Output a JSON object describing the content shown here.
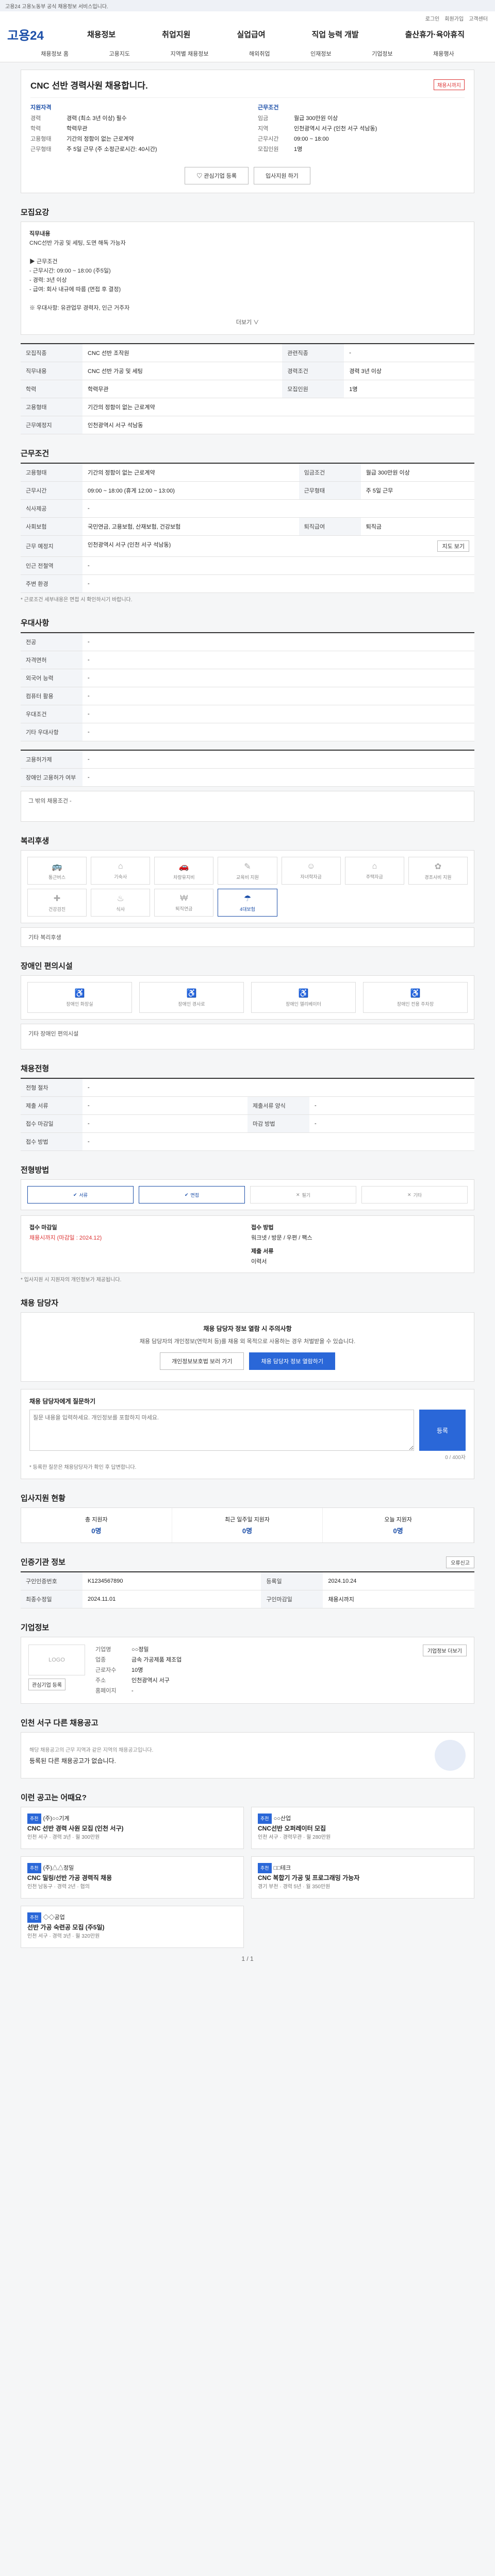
{
  "topstrip": {
    "text": "고용24 고용노동부 공식 채용정보 서비스입니다."
  },
  "header": {
    "logo": "고용24",
    "top_links": [
      "로그인",
      "회원가입",
      "고객센터"
    ],
    "gnb": [
      "채용정보",
      "취업지원",
      "실업급여",
      "직업 능력 개발",
      "출산휴가·육아휴직"
    ],
    "subnav": [
      "채용정보 홈",
      "고용지도",
      "지역별 채용정보",
      "해외취업",
      "인재정보",
      "기업정보",
      "채용행사"
    ]
  },
  "job": {
    "title": "CNC 선반 경력사원 채용합니다.",
    "badge": "채용시까지",
    "left_head": "지원자격",
    "right_head": "근무조건",
    "left_kv": [
      [
        "경력",
        "경력 (최소 3년 이상) 필수"
      ],
      [
        "학력",
        "학력무관"
      ],
      [
        "고용형태",
        "기간의 정함이 없는 근로계약"
      ],
      [
        "근무형태",
        "주 5일 근무 (주 소정근로시간: 40시간)"
      ]
    ],
    "right_kv": [
      [
        "임금",
        "월급 300만원 이상"
      ],
      [
        "지역",
        "인천광역시 서구 (인천 서구 석남동)"
      ],
      [
        "근무시간",
        "09:00 ~ 18:00"
      ],
      [
        "모집인원",
        "1명"
      ]
    ],
    "btn_like": "관심기업 등록",
    "btn_apply": "입사지원 하기"
  },
  "intro": {
    "title": "모집요강",
    "body": [
      "직무내용",
      "CNC선반 가공 및 세팅, 도면 해독 가능자",
      "▶ 근무조건",
      " - 근무시간: 09:00 ~ 18:00 (주5일)",
      " - 경력: 3년 이상",
      " - 급여: 회사 내규에 따름 (면접 후 결정)",
      "※ 우대사항: 유관업무 경력자, 인근 거주자"
    ],
    "more": "더보기 ∨"
  },
  "recruit": {
    "rows": [
      [
        "모집직종",
        "CNC 선반 조작원",
        "관련직종",
        "-"
      ],
      [
        "직무내용",
        "CNC 선반 가공 및 세팅",
        "경력조건",
        "경력 3년 이상"
      ],
      [
        "학력",
        "학력무관",
        "모집인원",
        "1명"
      ],
      [
        "고용형태",
        "기간의 정함이 없는 근로계약",
        "",
        ""
      ],
      [
        "근무예정지",
        "인천광역시 서구 석남동",
        "",
        ""
      ]
    ]
  },
  "conditions": {
    "title": "근무조건",
    "rows": [
      [
        "고용형태",
        "기간의 정함이 없는 근로계약",
        "임금조건",
        "월급 300만원 이상"
      ],
      [
        "근무시간",
        "09:00 ~ 18:00 (휴게 12:00 ~ 13:00)",
        "근무형태",
        "주 5일 근무"
      ],
      [
        "식사제공",
        "-",
        "",
        ""
      ],
      [
        "사회보험",
        "국민연금, 고용보험, 산재보험, 건강보험",
        "퇴직급여",
        "퇴직금"
      ],
      [
        "근무 예정지",
        "인천광역시 서구 (인천 서구 석남동)",
        "",
        ""
      ],
      [
        "인근 전철역",
        "-",
        "",
        ""
      ],
      [
        "주변 환경",
        "-",
        "",
        ""
      ]
    ],
    "map_btn": "지도 보기",
    "note": "* 근로조건 세부내용은 면접 시 확인하시기 바랍니다."
  },
  "pref": {
    "title": "우대사항",
    "rows": [
      [
        "전공",
        "-"
      ],
      [
        "자격면허",
        "-"
      ],
      [
        "외국어 능력",
        "-"
      ],
      [
        "컴퓨터 활용",
        "-"
      ],
      [
        "우대조건",
        "-"
      ],
      [
        "기타 우대사항",
        "-"
      ]
    ]
  },
  "other": {
    "rows": [
      [
        "고용허가제",
        "-"
      ],
      [
        "장애인 고용허가 여부",
        "-"
      ]
    ],
    "extra": "그 밖의 채용조건 -"
  },
  "welfare": {
    "title": "복리후생",
    "items": [
      {
        "label": "통근버스",
        "icon": "bus"
      },
      {
        "label": "기숙사",
        "icon": "home"
      },
      {
        "label": "차량유지비",
        "icon": "car"
      },
      {
        "label": "교육비 지원",
        "icon": "book"
      },
      {
        "label": "자녀학자금",
        "icon": "child"
      },
      {
        "label": "주택자금",
        "icon": "house"
      },
      {
        "label": "경조사비 지원",
        "icon": "gift"
      },
      {
        "label": "건강검진",
        "icon": "health"
      },
      {
        "label": "식사",
        "icon": "meal"
      },
      {
        "label": "퇴직연금",
        "icon": "pension"
      },
      {
        "label": "4대보험",
        "icon": "insure"
      }
    ],
    "active": [
      10
    ],
    "extra": "기타 복리후생"
  },
  "disabled": {
    "title": "장애인 편의시설",
    "items": [
      "장애인 화장실",
      "장애인 경사로",
      "장애인 엘리베이터",
      "장애인 전용 주차장"
    ],
    "extra": "기타 장애인 편의시설"
  },
  "process": {
    "title": "채용전형",
    "rows": [
      [
        "전형 절차",
        "-",
        "",
        ""
      ],
      [
        "제출 서류",
        "-",
        "제출서류 양식",
        "-"
      ],
      [
        "접수 마감일",
        "-",
        "마감 방법",
        "-"
      ],
      [
        "접수 방법",
        "-",
        "",
        ""
      ]
    ]
  },
  "apply_method": {
    "title": "전형방법",
    "methods": [
      {
        "label": "서류",
        "on": true
      },
      {
        "label": "면접",
        "on": true
      },
      {
        "label": "필기",
        "on": false
      },
      {
        "label": "기타",
        "on": false
      }
    ],
    "left_head": "접수 마감일",
    "left_val": "채용시까지 (마감일 : 2024.12)",
    "right_head": "접수 방법",
    "right_val": "워크넷 / 방문 / 우편 / 팩스",
    "doc_head": "제출 서류",
    "doc_val": "이력서",
    "note": "* 입사지원 시 지원자의 개인정보가 제공됩니다."
  },
  "contact": {
    "title": "채용 담당자",
    "head": "채용 담당자 정보 열람 시 주의사항",
    "body": "채용 담당자의 개인정보(연락처 등)를 채용 외 목적으로 사용하는 경우 처벌받을 수 있습니다.",
    "btn1": "개인정보보호법 보러 가기",
    "btn2": "채용 담당자 정보 열람하기"
  },
  "inquiry": {
    "title": "채용 담당자에게 질문하기",
    "placeholder": "질문 내용을 입력하세요. 개인정보를 포함하지 마세요.",
    "btn": "등록",
    "counter": "0 / 400자",
    "note": "* 등록한 질문은 채용담당자가 확인 후 답변합니다."
  },
  "status": {
    "title": "입사지원 현황",
    "items": [
      {
        "k": "총 지원자",
        "v": "0명"
      },
      {
        "k": "최근 일주일 지원자",
        "v": "0명"
      },
      {
        "k": "오늘 지원자",
        "v": "0명"
      }
    ]
  },
  "info": {
    "title": "인증기관 정보",
    "rows": [
      [
        "구인인증번호",
        "K1234567890",
        "등록일",
        "2024.10.24"
      ],
      [
        "최종수정일",
        "2024.11.01",
        "구인마감일",
        "채용시까지"
      ]
    ],
    "btn": "오류신고"
  },
  "company": {
    "title": "기업정보",
    "logo": "LOGO",
    "rows": [
      [
        "기업명",
        "○○정밀"
      ],
      [
        "업종",
        "금속 가공제품 제조업"
      ],
      [
        "근로자수",
        "10명"
      ],
      [
        "주소",
        "인천광역시 서구"
      ],
      [
        "홈페이지",
        "-"
      ]
    ],
    "btn_follow": "관심기업 등록",
    "btn_more": "기업정보 더보기"
  },
  "nearby": {
    "title": "인천 서구 다른 채용공고",
    "text": "해당 채용공고의 근무 지역과 같은 지역의 채용공고입니다.",
    "empty": "등록된 다른 채용공고가 없습니다."
  },
  "similar": {
    "title": "이런 공고는 어때요?",
    "items": [
      {
        "tag": "추천",
        "company": "(주)○○기계",
        "title": "CNC 선반 경력 사원 모집 (인천 서구)",
        "meta": "인천 서구 · 경력 3년 · 월 300만원"
      },
      {
        "tag": "추천",
        "company": "○○산업",
        "title": "CNC선반 오퍼레이터 모집",
        "meta": "인천 서구 · 경력무관 · 월 280만원"
      },
      {
        "tag": "추천",
        "company": "(주)△△정밀",
        "title": "CNC 밀링/선반 가공 경력직 채용",
        "meta": "인천 남동구 · 경력 2년 · 협의"
      },
      {
        "tag": "추천",
        "company": "□□테크",
        "title": "CNC 복합기 가공 및 프로그래밍 가능자",
        "meta": "경기 부천 · 경력 5년 · 월 350만원"
      },
      {
        "tag": "추천",
        "company": "◇◇공업",
        "title": "선반 가공 숙련공 모집 (주5일)",
        "meta": "인천 서구 · 경력 3년 · 월 320만원"
      }
    ]
  },
  "pager": "1 / 1"
}
